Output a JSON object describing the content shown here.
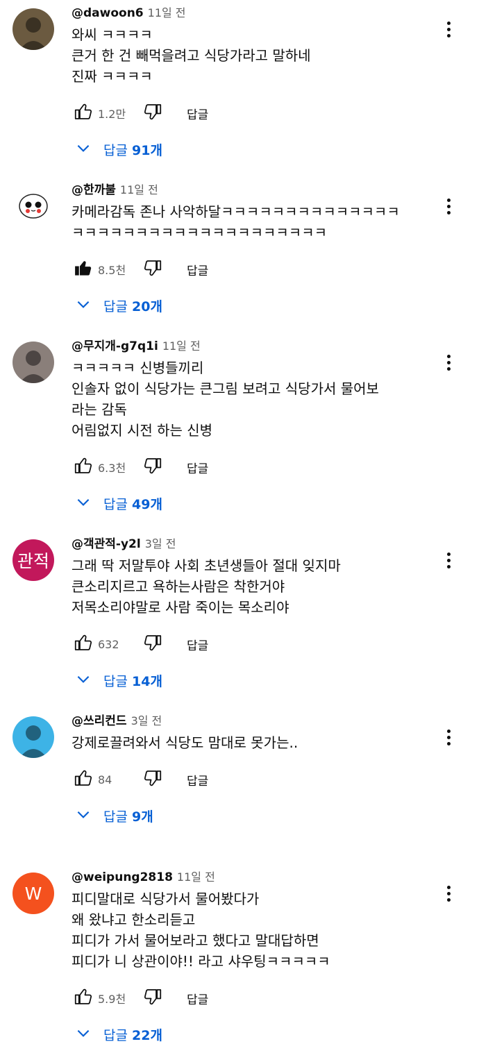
{
  "comments": [
    {
      "author": "@dawoon6",
      "time": "11일 전",
      "lines": [
        "와씨 ㅋㅋㅋㅋ",
        "큰거 한 건 빼먹을려고 식당가라고 말하네",
        "진짜 ㅋㅋㅋㅋ"
      ],
      "likes": "1.2만",
      "liked": false,
      "reply_label": "답글",
      "replies_label": "답글",
      "replies_count": "91개",
      "avatar": {
        "type": "photo",
        "bg": "#6b5a40"
      }
    },
    {
      "author": "@한까불",
      "time": "11일 전",
      "lines": [
        "카메라감독 존나 사악하달ㅋㅋㅋㅋㅋㅋㅋㅋㅋㅋㅋㅋㅋㅋ",
        "ㅋㅋㅋㅋㅋㅋㅋㅋㅋㅋㅋㅋㅋㅋㅋㅋㅋㅋㅋㅋ"
      ],
      "likes": "8.5천",
      "liked": true,
      "reply_label": "답글",
      "replies_label": "답글",
      "replies_count": "20개",
      "avatar": {
        "type": "cartoon",
        "bg": "#ffffff"
      }
    },
    {
      "author": "@무지개-g7q1i",
      "time": "11일 전",
      "lines": [
        "ㅋㅋㅋㅋㅋ 신병들끼리",
        "인솔자 없이 식당가는 큰그림 보려고 식당가서 물어보",
        "라는 감독",
        "어림없지 시전 하는 신병"
      ],
      "likes": "6.3천",
      "liked": false,
      "reply_label": "답글",
      "replies_label": "답글",
      "replies_count": "49개",
      "avatar": {
        "type": "photo",
        "bg": "#8a7f7a"
      }
    },
    {
      "author": "@객관적-y2l",
      "time": "3일 전",
      "lines": [
        "그래 딱 저말투야 사회 초년생들아 절대 잊지마",
        "큰소리지르고 욕하는사람은 착한거야",
        "저목소리야말로 사람 죽이는 목소리야"
      ],
      "likes": "632",
      "liked": false,
      "reply_label": "답글",
      "replies_label": "답글",
      "replies_count": "14개",
      "avatar": {
        "type": "letter",
        "letter": "관적",
        "bg": "#c2185b"
      }
    },
    {
      "author": "@쓰리컨드",
      "time": "3일 전",
      "lines": [
        "강제로끌려와서 식당도 맘대로 못가는.."
      ],
      "likes": "84",
      "liked": false,
      "reply_label": "답글",
      "replies_label": "답글",
      "replies_count": "9개",
      "avatar": {
        "type": "photo",
        "bg": "#3db3e6"
      }
    },
    {
      "author": "@weipung2818",
      "time": "11일 전",
      "lines": [
        "피디말대로 식당가서 물어봤다가",
        "왜 왔냐고 한소리듣고",
        "피디가 가서 물어보라고 했다고 말대답하면",
        "피디가 니 상관이야!! 라고 샤우팅ㅋㅋㅋㅋㅋ"
      ],
      "likes": "5.9천",
      "liked": false,
      "reply_label": "답글",
      "replies_label": "답글",
      "replies_count": "22개",
      "avatar": {
        "type": "letter",
        "letter": "W",
        "bg": "#f4511e"
      }
    }
  ],
  "colors": {
    "link": "#065fd4",
    "secondary": "#606060",
    "text": "#0f0f0f"
  },
  "icons": {
    "like": "thumb-up-icon",
    "dislike": "thumb-down-icon",
    "expand": "chevron-down-icon",
    "menu": "more-vert-icon"
  }
}
